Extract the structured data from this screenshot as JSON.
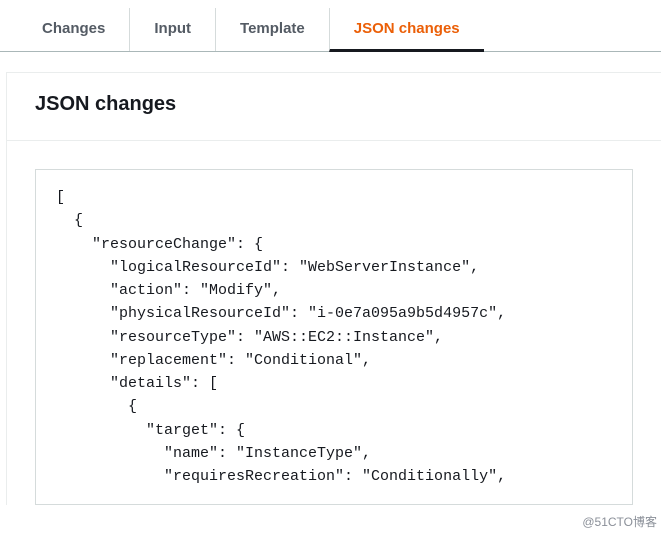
{
  "tabs": {
    "items": [
      {
        "label": "Changes",
        "active": false
      },
      {
        "label": "Input",
        "active": false
      },
      {
        "label": "Template",
        "active": false
      },
      {
        "label": "JSON changes",
        "active": true
      }
    ]
  },
  "section": {
    "title": "JSON changes"
  },
  "code": {
    "content": "[\n  {\n    \"resourceChange\": {\n      \"logicalResourceId\": \"WebServerInstance\",\n      \"action\": \"Modify\",\n      \"physicalResourceId\": \"i-0e7a095a9b5d4957c\",\n      \"resourceType\": \"AWS::EC2::Instance\",\n      \"replacement\": \"Conditional\",\n      \"details\": [\n        {\n          \"target\": {\n            \"name\": \"InstanceType\",\n            \"requiresRecreation\": \"Conditionally\","
  },
  "watermark": "@51CTO博客"
}
